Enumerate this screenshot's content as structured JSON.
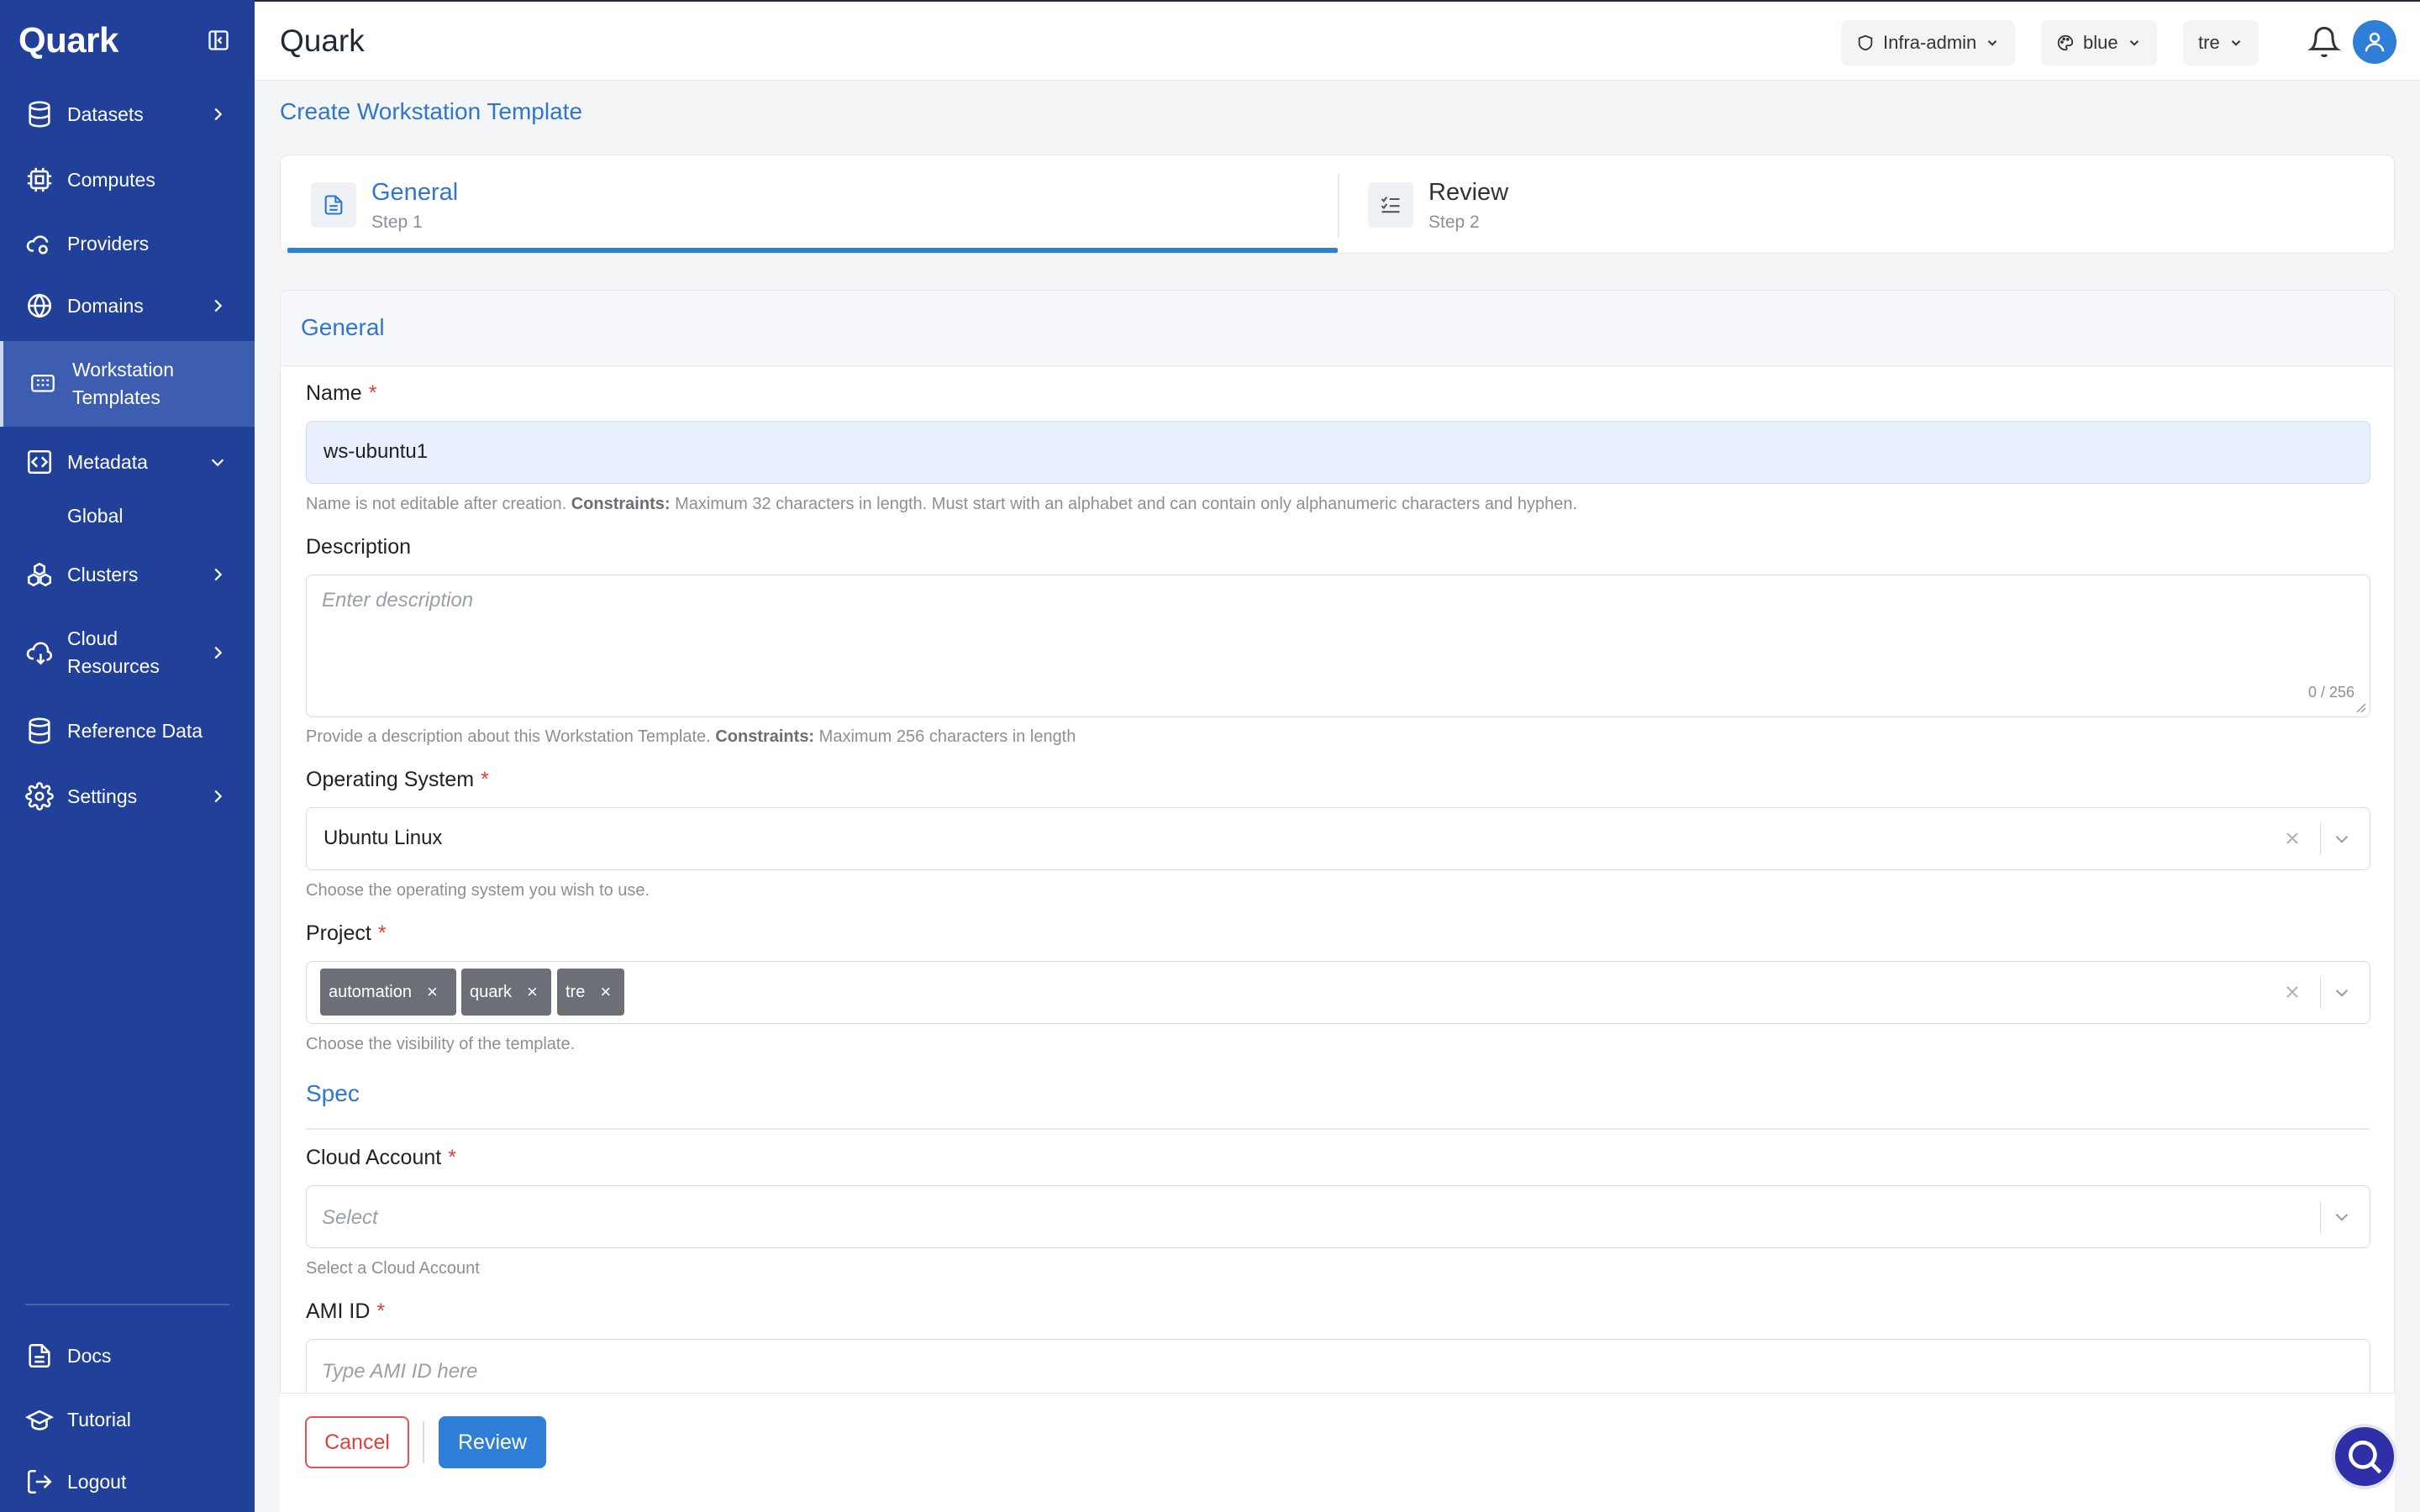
{
  "brand": "Quark",
  "sidebar": {
    "items": [
      {
        "label": "Datasets",
        "icon": "database-icon"
      },
      {
        "label": "Computes",
        "icon": "cpu-icon"
      },
      {
        "label": "Providers",
        "icon": "cloud-gear-icon"
      },
      {
        "label": "Domains",
        "icon": "globe-icon"
      },
      {
        "label": "Workstation Templates",
        "icon": "workstation-icon"
      },
      {
        "label": "Metadata",
        "icon": "code-bracket-icon"
      },
      {
        "label": "Global"
      },
      {
        "label": "Clusters",
        "icon": "cluster-icon"
      },
      {
        "label": "Cloud Resources",
        "icon": "cloud-download-icon"
      },
      {
        "label": "Reference Data",
        "icon": "database-icon"
      },
      {
        "label": "Settings",
        "icon": "gear-icon"
      }
    ],
    "footer": [
      {
        "label": "Docs",
        "icon": "document-icon"
      },
      {
        "label": "Tutorial",
        "icon": "graduation-cap-icon"
      },
      {
        "label": "Logout",
        "icon": "logout-icon"
      }
    ]
  },
  "header": {
    "title": "Quark",
    "role": "Infra-admin",
    "theme": "blue",
    "tenant": "tre"
  },
  "page": {
    "heading": "Create Workstation Template"
  },
  "steps": [
    {
      "title": "General",
      "subtitle": "Step 1"
    },
    {
      "title": "Review",
      "subtitle": "Step 2"
    }
  ],
  "form": {
    "section_title": "General",
    "name": {
      "label": "Name",
      "value": "ws-ubuntu1",
      "help_text": "Name is not editable after creation.",
      "help_constraints_label": "Constraints:",
      "help_constraints": "Maximum 32 characters in length. Must start with an alphabet and can contain only alphanumeric characters and hyphen."
    },
    "description": {
      "label": "Description",
      "placeholder": "Enter description",
      "counter": "0 / 256",
      "help_text": "Provide a description about this Workstation Template.",
      "help_constraints_label": "Constraints:",
      "help_constraints": "Maximum 256 characters in length"
    },
    "os": {
      "label": "Operating System",
      "value": "Ubuntu Linux",
      "help": "Choose the operating system you wish to use."
    },
    "project": {
      "label": "Project",
      "tags": [
        "automation",
        "quark",
        "tre"
      ],
      "help": "Choose the visibility of the template."
    },
    "spec_title": "Spec",
    "cloud_account": {
      "label": "Cloud Account",
      "placeholder": "Select",
      "help": "Select a Cloud Account"
    },
    "ami": {
      "label": "AMI ID",
      "placeholder": "Type AMI ID here"
    }
  },
  "actions": {
    "cancel": "Cancel",
    "review": "Review"
  },
  "colors": {
    "sidebar": "#21409a",
    "accent": "#2f7fd8",
    "danger": "#e0413c"
  }
}
